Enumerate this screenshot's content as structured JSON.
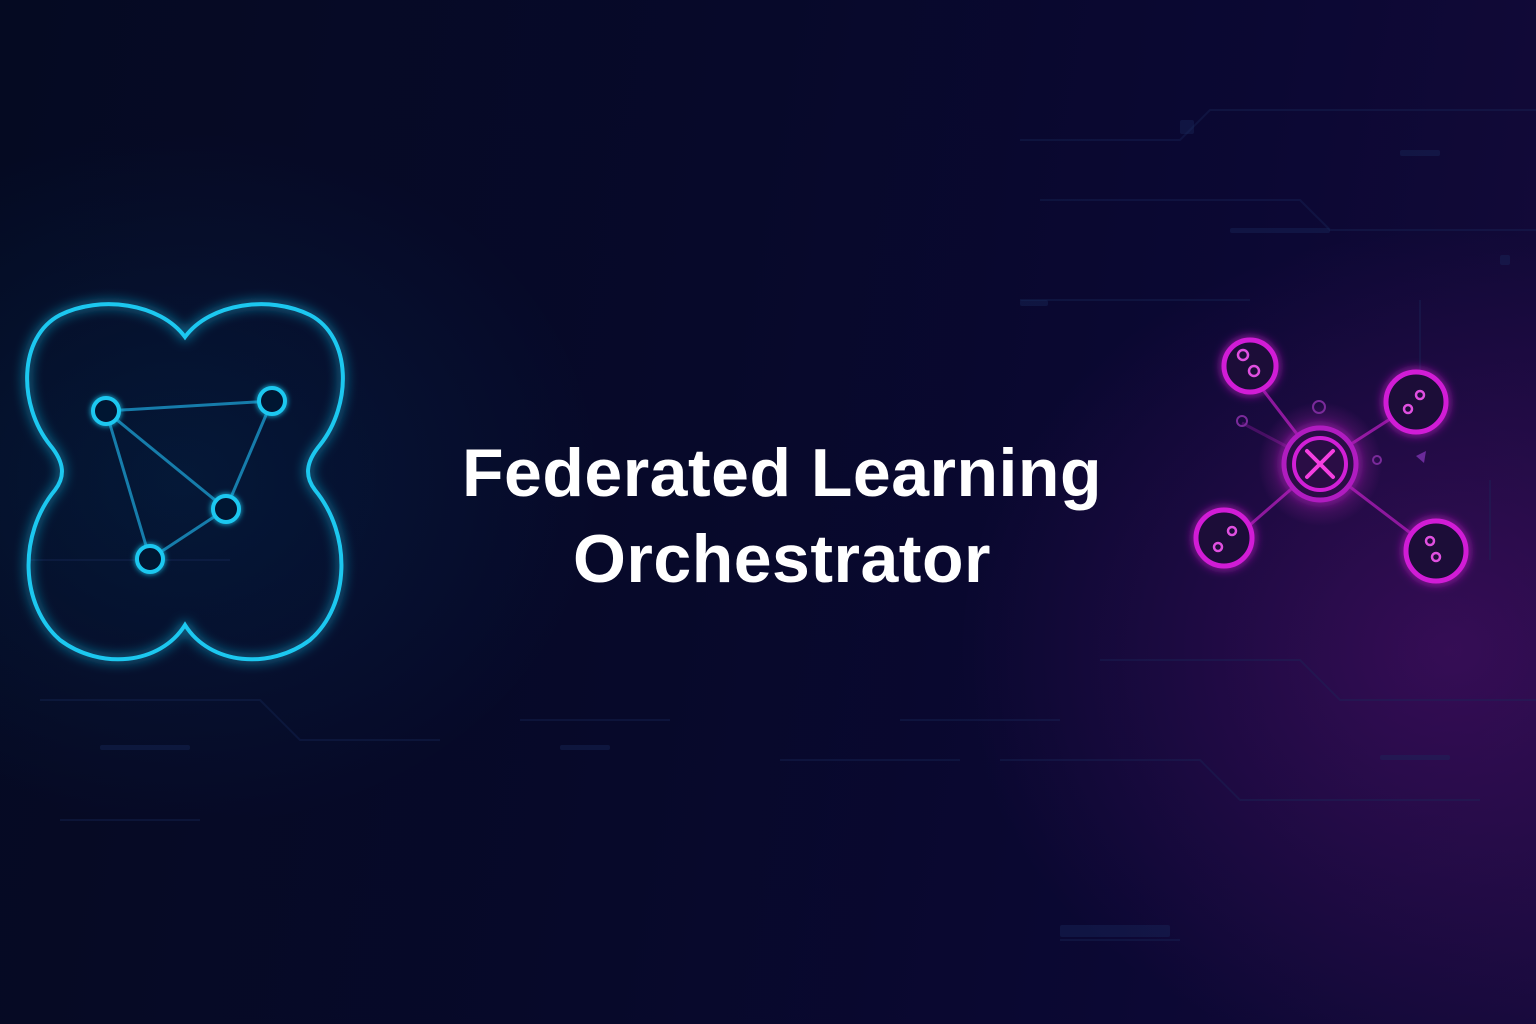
{
  "title": {
    "line1": "Federated Learning",
    "line2": "Orchestrator"
  },
  "icons": {
    "left": "federated-network-icon",
    "right": "central-hub-icon"
  },
  "colors": {
    "background": "#060b24",
    "left_accent": "#1fc8f0",
    "right_accent": "#d11fd6",
    "text": "#ffffff"
  }
}
